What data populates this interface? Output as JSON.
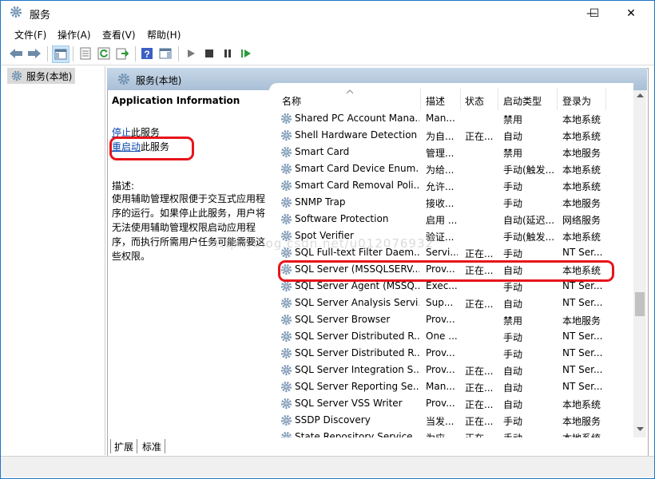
{
  "window": {
    "title": "服务",
    "minimize": "—",
    "maximize": "☐",
    "close": "✕"
  },
  "menu": [
    "文件(F)",
    "操作(A)",
    "查看(V)",
    "帮助(H)"
  ],
  "tree": {
    "item": "服务(本地)"
  },
  "banner": {
    "title": "服务(本地)"
  },
  "description": {
    "title": "Application Information",
    "stop_link": "停止",
    "stop_suffix": "此服务",
    "restart_link": "重启动",
    "restart_suffix": "此服务",
    "label": "描述:",
    "body": "使用辅助管理权限便于交互式应用程序的运行。如果停止此服务，用户将无法使用辅助管理权限启动应用程序，而执行所需用户任务可能需要这些权限。"
  },
  "columns": [
    "名称",
    "描述",
    "状态",
    "启动类型",
    "登录为"
  ],
  "rows": [
    {
      "name": "Shared PC Account Mana...",
      "desc": "Man...",
      "status": "",
      "startup": "禁用",
      "logon": "本地系统"
    },
    {
      "name": "Shell Hardware Detection",
      "desc": "为自...",
      "status": "正在...",
      "startup": "自动",
      "logon": "本地系统"
    },
    {
      "name": "Smart Card",
      "desc": "管理...",
      "status": "",
      "startup": "禁用",
      "logon": "本地服务"
    },
    {
      "name": "Smart Card Device Enum...",
      "desc": "为给...",
      "status": "",
      "startup": "手动(触发...",
      "logon": "本地系统"
    },
    {
      "name": "Smart Card Removal Poli...",
      "desc": "允许...",
      "status": "",
      "startup": "手动",
      "logon": "本地系统"
    },
    {
      "name": "SNMP Trap",
      "desc": "接收...",
      "status": "",
      "startup": "手动",
      "logon": "本地服务"
    },
    {
      "name": "Software Protection",
      "desc": "启用 ...",
      "status": "",
      "startup": "自动(延迟...",
      "logon": "网络服务"
    },
    {
      "name": "Spot Verifier",
      "desc": "验证...",
      "status": "",
      "startup": "手动(触发...",
      "logon": "本地系统"
    },
    {
      "name": "SQL Full-text Filter Daem...",
      "desc": "Servi...",
      "status": "正在...",
      "startup": "手动",
      "logon": "NT Ser..."
    },
    {
      "name": "SQL Server (MSSQLSERV...",
      "desc": "Prov...",
      "status": "正在...",
      "startup": "自动",
      "logon": "本地系统"
    },
    {
      "name": "SQL Server Agent (MSSQ...",
      "desc": "Exec...",
      "status": "",
      "startup": "手动",
      "logon": "NT Ser..."
    },
    {
      "name": "SQL Server Analysis Servi...",
      "desc": "Sup...",
      "status": "正在...",
      "startup": "自动",
      "logon": "NT Ser..."
    },
    {
      "name": "SQL Server Browser",
      "desc": "Prov...",
      "status": "",
      "startup": "禁用",
      "logon": "本地服务"
    },
    {
      "name": "SQL Server Distributed R...",
      "desc": "One ...",
      "status": "",
      "startup": "手动",
      "logon": "NT Ser..."
    },
    {
      "name": "SQL Server Distributed R...",
      "desc": "Prov...",
      "status": "",
      "startup": "手动",
      "logon": "NT Ser..."
    },
    {
      "name": "SQL Server Integration S...",
      "desc": "Prov...",
      "status": "正在...",
      "startup": "自动",
      "logon": "NT Ser..."
    },
    {
      "name": "SQL Server Reporting Se...",
      "desc": "Man...",
      "status": "正在...",
      "startup": "自动",
      "logon": "NT Ser..."
    },
    {
      "name": "SQL Server VSS Writer",
      "desc": "Prov...",
      "status": "正在...",
      "startup": "自动",
      "logon": "本地系统"
    },
    {
      "name": "SSDP Discovery",
      "desc": "当发...",
      "status": "正在...",
      "startup": "手动",
      "logon": "本地服务"
    },
    {
      "name": "State Repository Service",
      "desc": "为应...",
      "status": "正在...",
      "startup": "手动",
      "logon": "本地系统"
    }
  ],
  "tabs": [
    "扩展",
    "标准"
  ],
  "watermark": "http://blog.csdn.net/u012076932",
  "colors": {
    "highlight_oval": "#e8141b",
    "link": "#0645ad",
    "banner": "#b7cbe0"
  }
}
